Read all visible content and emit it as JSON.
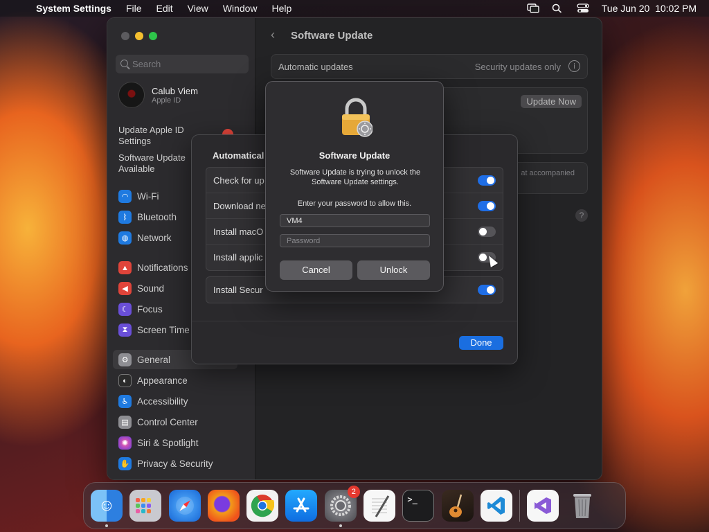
{
  "menubar": {
    "app_name": "System Settings",
    "items": [
      "File",
      "Edit",
      "View",
      "Window",
      "Help"
    ],
    "datetime": "Tue Jun 20  10:02 PM"
  },
  "sidebar": {
    "search_placeholder": "Search",
    "profile": {
      "name": "Calub Viem",
      "sub": "Apple ID"
    },
    "notes": [
      "Update Apple ID Settings",
      "Software Update Available"
    ],
    "items": [
      {
        "label": "Wi-Fi",
        "color": "#1f7ae0",
        "icon": "wifi-icon"
      },
      {
        "label": "Bluetooth",
        "color": "#1f7ae0",
        "icon": "bluetooth-icon"
      },
      {
        "label": "Network",
        "color": "#1f7ae0",
        "icon": "globe-icon"
      },
      {
        "label": "Notifications",
        "color": "#e0443a",
        "icon": "bell-icon"
      },
      {
        "label": "Sound",
        "color": "#e0443a",
        "icon": "speaker-icon"
      },
      {
        "label": "Focus",
        "color": "#6a4fd8",
        "icon": "moon-icon"
      },
      {
        "label": "Screen Time",
        "color": "#6a4fd8",
        "icon": "hourglass-icon"
      },
      {
        "label": "General",
        "color": "#8e8e93",
        "icon": "gear-icon"
      },
      {
        "label": "Appearance",
        "color": "#2b2b2b",
        "icon": "appearance-icon"
      },
      {
        "label": "Accessibility",
        "color": "#1f7ae0",
        "icon": "accessibility-icon"
      },
      {
        "label": "Control Center",
        "color": "#8e8e93",
        "icon": "control-center-icon"
      },
      {
        "label": "Siri & Spotlight",
        "color": "#c23fd6",
        "icon": "siri-icon"
      },
      {
        "label": "Privacy & Security",
        "color": "#1f7ae0",
        "icon": "hand-icon"
      }
    ]
  },
  "main": {
    "title": "Software Update",
    "auto_updates_label": "Automatic updates",
    "auto_updates_value": "Security updates only",
    "update_now": "Update Now",
    "accompanied_note": "at accompanied"
  },
  "sheet": {
    "title": "Automatical",
    "rows": [
      {
        "label": "Check for up",
        "on": true
      },
      {
        "label": "Download ne",
        "on": true
      },
      {
        "label": "Install macO",
        "on": false
      },
      {
        "label": "Install applic",
        "on": false
      }
    ],
    "security_row": "Install Secur",
    "done": "Done"
  },
  "auth": {
    "title": "Software Update",
    "message": "Software Update is trying to unlock the Software Update settings.",
    "prompt": "Enter your password to allow this.",
    "username": "VM4",
    "password_placeholder": "Password",
    "cancel": "Cancel",
    "unlock": "Unlock"
  },
  "dock": {
    "settings_badge": "2",
    "apps": [
      {
        "name": "finder-app-icon",
        "color": "#3a8fe8",
        "glyph": "☺"
      },
      {
        "name": "launchpad-app-icon",
        "color": "#c9c9cf",
        "glyph": "⁘"
      },
      {
        "name": "safari-app-icon",
        "color": "#2a8ef0",
        "glyph": "✦"
      },
      {
        "name": "firefox-app-icon",
        "color": "#f06a1a",
        "glyph": "●"
      },
      {
        "name": "chrome-app-icon",
        "color": "#f2f2f2",
        "glyph": "◉"
      },
      {
        "name": "app-store-app-icon",
        "color": "#1b8ff2",
        "glyph": "A"
      },
      {
        "name": "system-settings-app-icon",
        "color": "#8a8a8e",
        "glyph": "⚙"
      },
      {
        "name": "textedit-app-icon",
        "color": "#f5f5f5",
        "glyph": "✎"
      },
      {
        "name": "terminal-app-icon",
        "color": "#1a1a1a",
        "glyph": ">_"
      },
      {
        "name": "garageband-app-icon",
        "color": "#a8552a",
        "glyph": "♪"
      },
      {
        "name": "vscode-app-icon",
        "color": "#f5f5f5",
        "glyph": "≺"
      }
    ],
    "pinned": [
      {
        "name": "visual-studio-app-icon",
        "color": "#f5f5f5",
        "glyph": "∞"
      },
      {
        "name": "trash-app-icon",
        "color": "#7a7a7e",
        "glyph": "▯"
      }
    ]
  }
}
